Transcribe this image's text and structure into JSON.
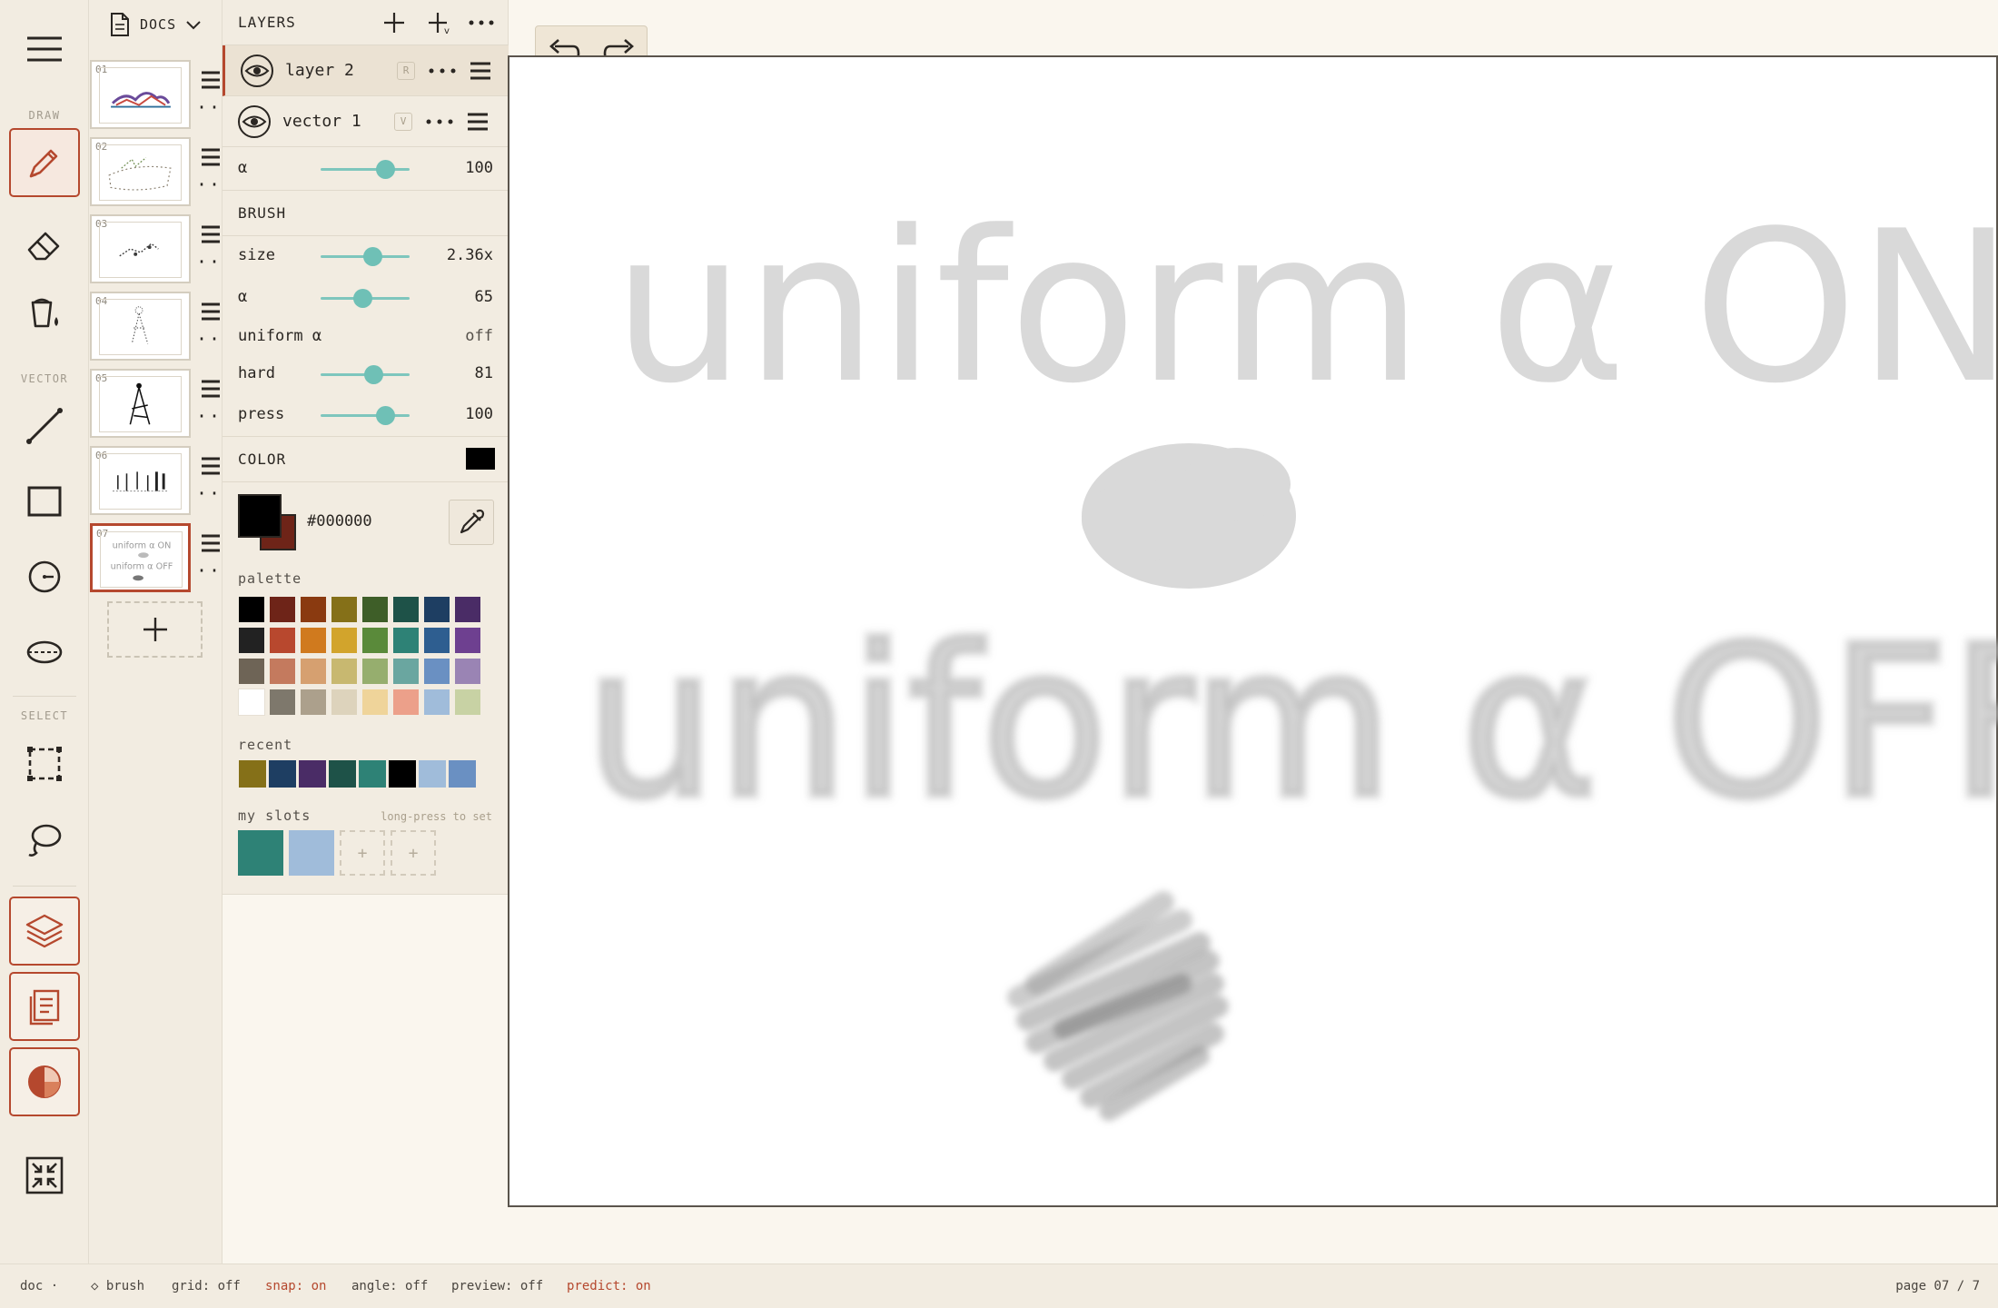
{
  "rail": {
    "draw_label": "DRAW",
    "vector_label": "VECTOR",
    "select_label": "SELECT"
  },
  "docs": {
    "header_label": "DOCS",
    "thumbnails": [
      {
        "num": "01"
      },
      {
        "num": "02"
      },
      {
        "num": "03"
      },
      {
        "num": "04"
      },
      {
        "num": "05"
      },
      {
        "num": "06"
      },
      {
        "num": "07"
      }
    ],
    "current_index": 6
  },
  "layers": {
    "title": "LAYERS",
    "items": [
      {
        "name": "layer 2",
        "tag": "R",
        "selected": true
      },
      {
        "name": "vector 1",
        "tag": "V",
        "selected": false
      }
    ],
    "alpha": {
      "label": "α",
      "value": "100"
    }
  },
  "brush": {
    "title": "BRUSH",
    "size": {
      "label": "size",
      "value": "2.36x",
      "level": 0.58
    },
    "alpha": {
      "label": "α",
      "value": "65",
      "level": 0.47
    },
    "uniform_alpha": {
      "label": "uniform α",
      "value": "off"
    },
    "hard": {
      "label": "hard",
      "value": "81",
      "level": 0.59
    },
    "press": {
      "label": "press",
      "value": "100",
      "level": 0.72
    }
  },
  "layer_alpha_level": 0.72,
  "color": {
    "title": "COLOR",
    "current": "#000000",
    "hex_text": "#000000",
    "secondary": "#6e2418",
    "palette_label": "palette",
    "palette": [
      "#000000",
      "#6e2418",
      "#8a3a10",
      "#857018",
      "#3e5e28",
      "#1e5248",
      "#1e3e62",
      "#4a2c66",
      "#222222",
      "#b8482e",
      "#d07a1e",
      "#d2a42c",
      "#5a8a3a",
      "#2e8276",
      "#2e5e90",
      "#6e4090",
      "#6e6456",
      "#c47a5e",
      "#d6a070",
      "#c8b870",
      "#96ae6e",
      "#6aa6a0",
      "#6a90c2",
      "#9a84b4",
      "#ffffff",
      "#7e786c",
      "#aca08c",
      "#ddd3bc",
      "#efd49a",
      "#eca08a",
      "#a0bcda",
      "#c8d2a4"
    ],
    "recent_label": "recent",
    "recent": [
      "#857018",
      "#1e3e62",
      "#4a2c66",
      "#1e5248",
      "#2e8276",
      "#000000",
      "#a0bcda",
      "#6a90c2"
    ],
    "slots_label": "my slots",
    "slots_hint": "long-press to set",
    "slots": [
      "#2e8276",
      "#a0bcda"
    ],
    "empty_slot": "+"
  },
  "canvas": {
    "text_top": "uniform α ON",
    "text_bottom": "uniform α OFF"
  },
  "status": {
    "doc": "doc ·",
    "tool": "◇ brush",
    "grid": "grid: off",
    "snap": "snap: on",
    "angle": "angle: off",
    "preview": "preview: off",
    "predict": "predict: on",
    "page": "page 07 / 7"
  }
}
